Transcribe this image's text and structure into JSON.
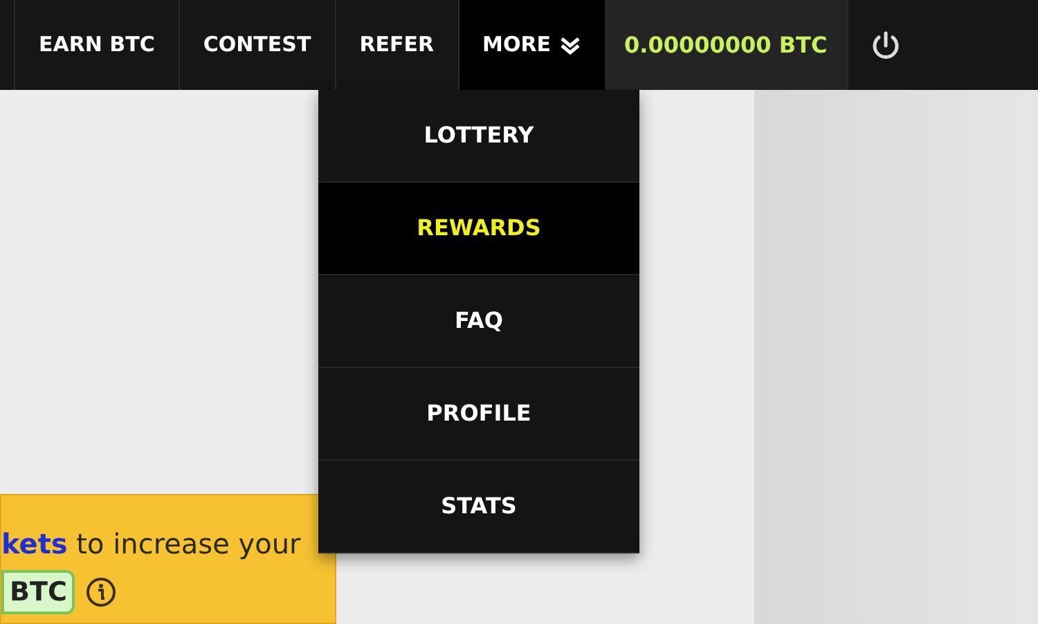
{
  "nav": {
    "items": [
      {
        "label": "EARN BTC",
        "selected": false
      },
      {
        "label": "CONTEST",
        "selected": false
      },
      {
        "label": "REFER",
        "selected": false
      },
      {
        "label": "MORE",
        "selected": true
      }
    ],
    "balance": "0.00000000 BTC"
  },
  "menu": {
    "items": [
      {
        "label": "LOTTERY",
        "selected": false
      },
      {
        "label": "REWARDS",
        "selected": true
      },
      {
        "label": "FAQ",
        "selected": false
      },
      {
        "label": "PROFILE",
        "selected": false
      },
      {
        "label": "STATS",
        "selected": false
      }
    ]
  },
  "notice": {
    "link": "kets",
    "text": " to increase your",
    "badge": "BTC"
  }
}
